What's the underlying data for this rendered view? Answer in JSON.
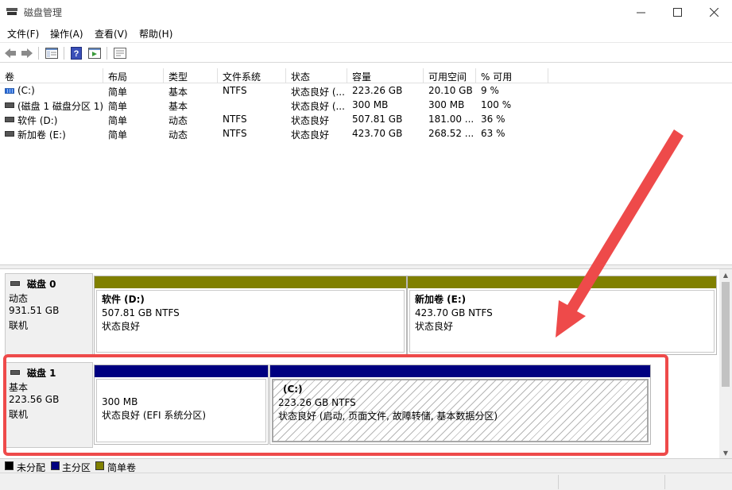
{
  "window": {
    "title": "磁盘管理",
    "minimize_icon": "minimize-icon",
    "maximize_icon": "maximize-icon",
    "close_icon": "close-icon"
  },
  "menu": {
    "file": "文件(F)",
    "action": "操作(A)",
    "view": "查看(V)",
    "help": "帮助(H)"
  },
  "toolbar": {
    "buttons": [
      "back-arrow-icon",
      "forward-arrow-icon",
      "console-tree-icon",
      "help-icon",
      "properties-icon",
      "settings-list-icon"
    ]
  },
  "volume_table": {
    "headers": [
      "卷",
      "布局",
      "类型",
      "文件系统",
      "状态",
      "容量",
      "可用空间",
      "% 可用"
    ],
    "rows": [
      {
        "volume": "(C:)",
        "layout": "简单",
        "type": "基本",
        "fs": "NTFS",
        "status": "状态良好 (...",
        "capacity": "223.26 GB",
        "free": "20.10 GB",
        "pct": "9 %"
      },
      {
        "volume": "(磁盘 1 磁盘分区 1)",
        "layout": "简单",
        "type": "基本",
        "fs": "",
        "status": "状态良好 (...",
        "capacity": "300 MB",
        "free": "300 MB",
        "pct": "100 %"
      },
      {
        "volume": "软件 (D:)",
        "layout": "简单",
        "type": "动态",
        "fs": "NTFS",
        "status": "状态良好",
        "capacity": "507.81 GB",
        "free": "181.00 ...",
        "pct": "36 %"
      },
      {
        "volume": "新加卷 (E:)",
        "layout": "简单",
        "type": "动态",
        "fs": "NTFS",
        "status": "状态良好",
        "capacity": "423.70 GB",
        "free": "268.52 ...",
        "pct": "63 %"
      }
    ]
  },
  "disks": [
    {
      "name": "磁盘 0",
      "kind": "动态",
      "size": "931.51 GB",
      "state": "联机",
      "partitions": [
        {
          "title": "软件   (D:)",
          "size_fs": "507.81 GB NTFS",
          "status": "状态良好"
        },
        {
          "title": "新加卷   (E:)",
          "size_fs": "423.70 GB NTFS",
          "status": "状态良好"
        }
      ]
    },
    {
      "name": "磁盘 1",
      "kind": "基本",
      "size": "223.56 GB",
      "state": "联机",
      "partitions": [
        {
          "title": "",
          "size_fs": "300 MB",
          "status": "状态良好 (EFI 系统分区)"
        },
        {
          "title": "(C:)",
          "size_fs": "223.26 GB NTFS",
          "status": "状态良好 (启动, 页面文件, 故障转储, 基本数据分区)"
        }
      ]
    }
  ],
  "legend": [
    {
      "label": "未分配",
      "color": "#000000"
    },
    {
      "label": "主分区",
      "color": "#000080"
    },
    {
      "label": "简单卷",
      "color": "#808000"
    }
  ],
  "colors": {
    "simple_volume_bar": "#808000",
    "primary_partition_bar": "#000080",
    "annotation_red": "#ee4a4a"
  }
}
